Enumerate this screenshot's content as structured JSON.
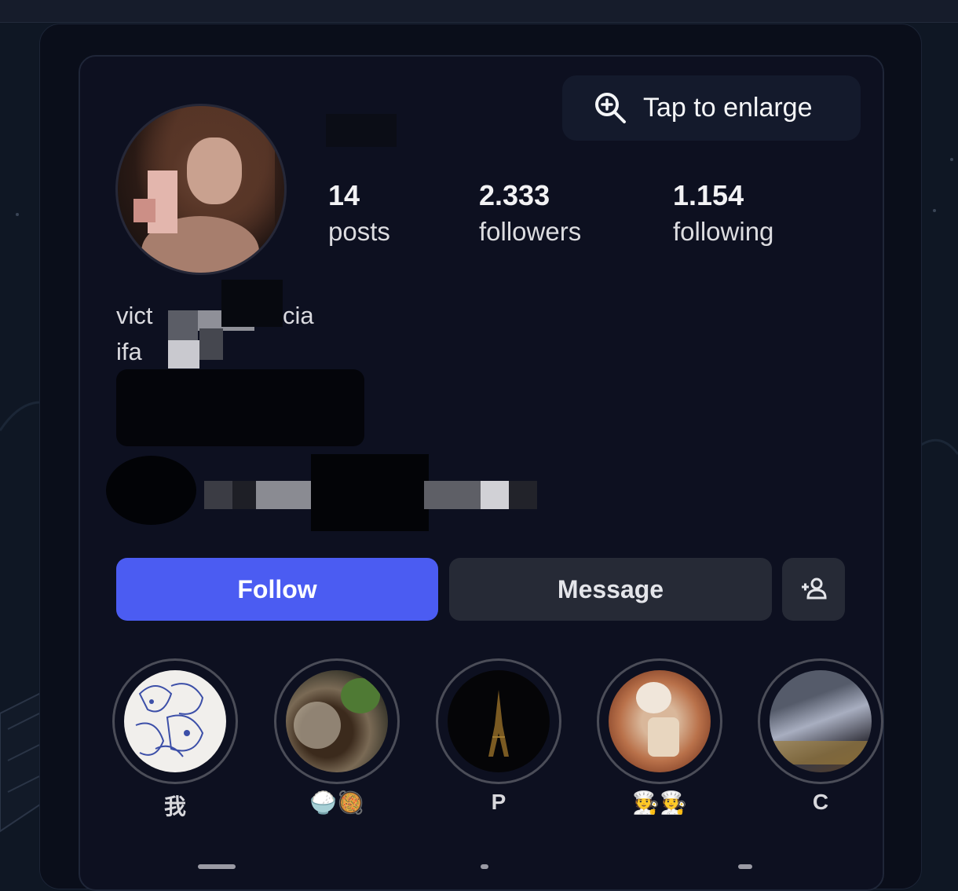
{
  "enlarge_button": {
    "label": "Tap to enlarge",
    "icon": "zoom-in-icon"
  },
  "profile": {
    "stats": [
      {
        "value": "14",
        "label": "posts"
      },
      {
        "value": "2.333",
        "label": "followers"
      },
      {
        "value": "1.154",
        "label": "following"
      }
    ],
    "bio": {
      "line1_start": "vict",
      "line1_end": "cia",
      "line2_start": "ifa"
    }
  },
  "actions": {
    "follow": "Follow",
    "message": "Message",
    "add_icon": "add-person-icon"
  },
  "highlights": [
    {
      "label": "我"
    },
    {
      "label": "🍚🥘"
    },
    {
      "label": "P"
    },
    {
      "label": "🧑‍🍳🧑‍🍳"
    },
    {
      "label": "C"
    }
  ],
  "colors": {
    "follow_button": "#4b5cf2",
    "secondary_button": "#262a36",
    "card_background": "#0d1020"
  }
}
